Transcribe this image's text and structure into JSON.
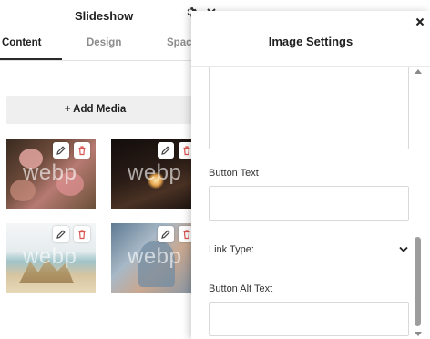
{
  "back_panel": {
    "title": "Slideshow",
    "tabs": [
      {
        "label": "Content",
        "active": true
      },
      {
        "label": "Design",
        "active": false
      },
      {
        "label": "Spaci",
        "active": false
      }
    ],
    "add_media_label": "+ Add Media",
    "thumbnails": [
      {
        "watermark": "webp",
        "subject": "pink roses bouquet"
      },
      {
        "watermark": "webp",
        "subject": "couple with sparkler at night"
      },
      {
        "watermark": "webp",
        "subject": "beach dune grass"
      },
      {
        "watermark": "webp",
        "subject": "couple embracing outdoors"
      }
    ]
  },
  "overlay": {
    "title": "Image Settings",
    "fields": {
      "button_text_label": "Button Text",
      "button_text_value": "",
      "link_type_label": "Link Type:",
      "button_alt_text_label": "Button Alt Text",
      "button_alt_text_value": ""
    }
  },
  "icons": [
    "gear-icon",
    "chevron-down-icon",
    "close-icon",
    "edit-pencil-icon",
    "trash-icon",
    "scroll-up-arrow-icon",
    "scroll-down-arrow-icon"
  ],
  "colors": {
    "delete_red": "#d9534f",
    "scrollbar_thumb": "#9d9d9d",
    "button_bg": "#efefef"
  }
}
